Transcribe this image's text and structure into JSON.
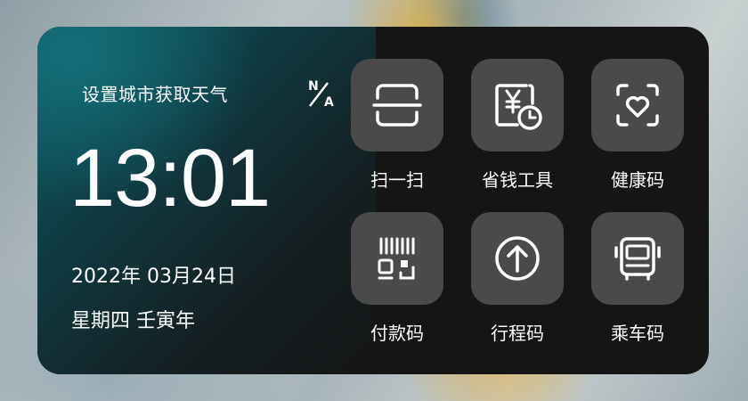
{
  "weather": {
    "prompt": "设置城市获取天气",
    "na_top": "N",
    "na_bottom": "A"
  },
  "clock": {
    "time": "13:01",
    "date": "2022年 03月24日",
    "lunar": "星期四 壬寅年"
  },
  "shortcuts": [
    {
      "label": "扫一扫",
      "icon": "scan-icon"
    },
    {
      "label": "省钱工具",
      "icon": "yen-clock-icon"
    },
    {
      "label": "健康码",
      "icon": "health-code-icon"
    },
    {
      "label": "付款码",
      "icon": "payment-code-icon"
    },
    {
      "label": "行程码",
      "icon": "arrow-up-circle-icon"
    },
    {
      "label": "乘车码",
      "icon": "bus-icon"
    }
  ],
  "colors": {
    "widget_bg": "#151515",
    "tile_bg": "#4a4a4a",
    "accent_teal": "#0d5a64"
  }
}
